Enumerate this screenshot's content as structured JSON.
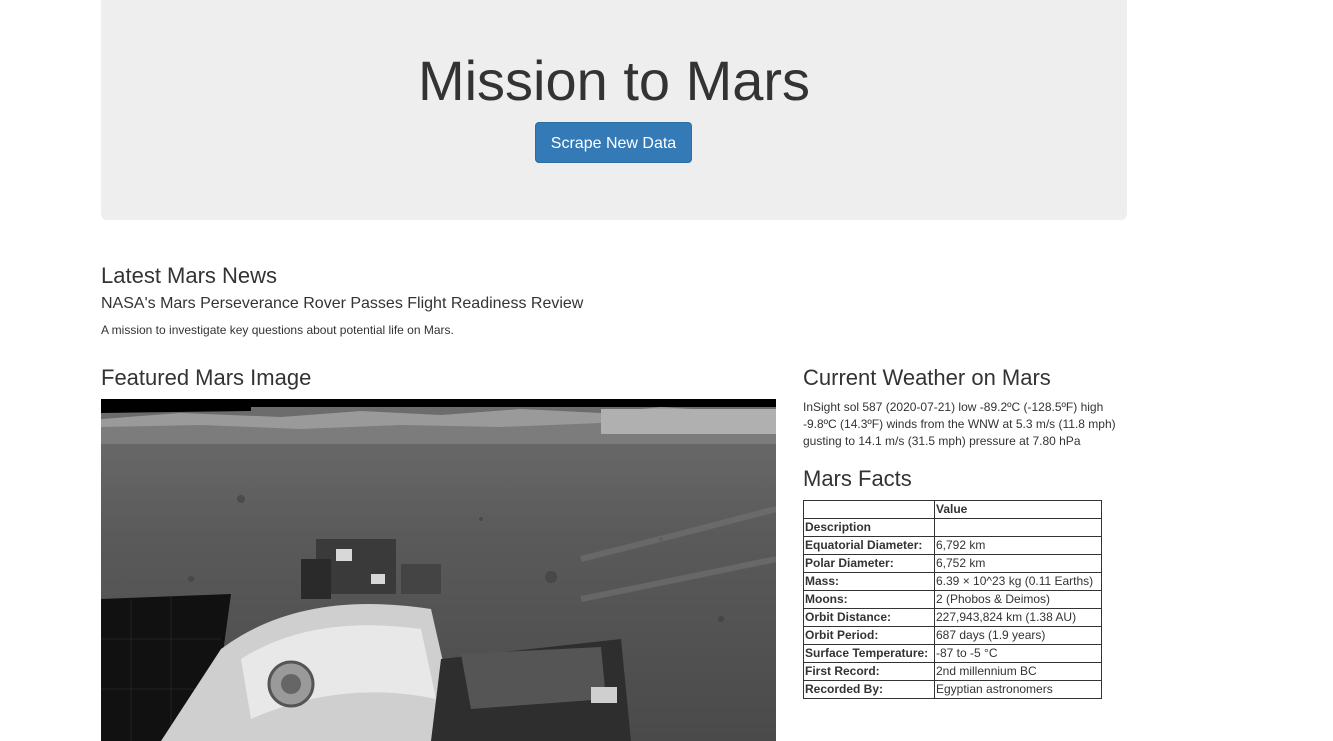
{
  "header": {
    "title": "Mission to Mars",
    "scrape_button_label": "Scrape New Data"
  },
  "news": {
    "heading": "Latest Mars News",
    "title": "NASA's Mars Perseverance Rover Passes Flight Readiness Review",
    "teaser": "A mission to investigate key questions about potential life on Mars."
  },
  "featured": {
    "heading": "Featured Mars Image"
  },
  "weather": {
    "heading": "Current Weather on Mars",
    "text": "InSight sol 587 (2020-07-21) low -89.2ºC (-128.5ºF) high -9.8ºC (14.3ºF) winds from the WNW at 5.3 m/s (11.8 mph) gusting to 14.1 m/s (31.5 mph) pressure at 7.80 hPa"
  },
  "facts": {
    "heading": "Mars Facts",
    "columns": [
      "",
      "Value"
    ],
    "index_name": "Description",
    "rows": [
      [
        "Equatorial Diameter:",
        "6,792 km"
      ],
      [
        "Polar Diameter:",
        "6,752 km"
      ],
      [
        "Mass:",
        "6.39 × 10^23 kg (0.11 Earths)"
      ],
      [
        "Moons:",
        "2 (Phobos & Deimos)"
      ],
      [
        "Orbit Distance:",
        "227,943,824 km (1.38 AU)"
      ],
      [
        "Orbit Period:",
        "687 days (1.9 years)"
      ],
      [
        "Surface Temperature:",
        "-87 to -5 °C"
      ],
      [
        "First Record:",
        "2nd millennium BC"
      ],
      [
        "Recorded By:",
        "Egyptian astronomers"
      ]
    ]
  },
  "colors": {
    "jumbotron_bg": "#eeeeee",
    "button_bg": "#337ab7",
    "text": "#333333"
  }
}
